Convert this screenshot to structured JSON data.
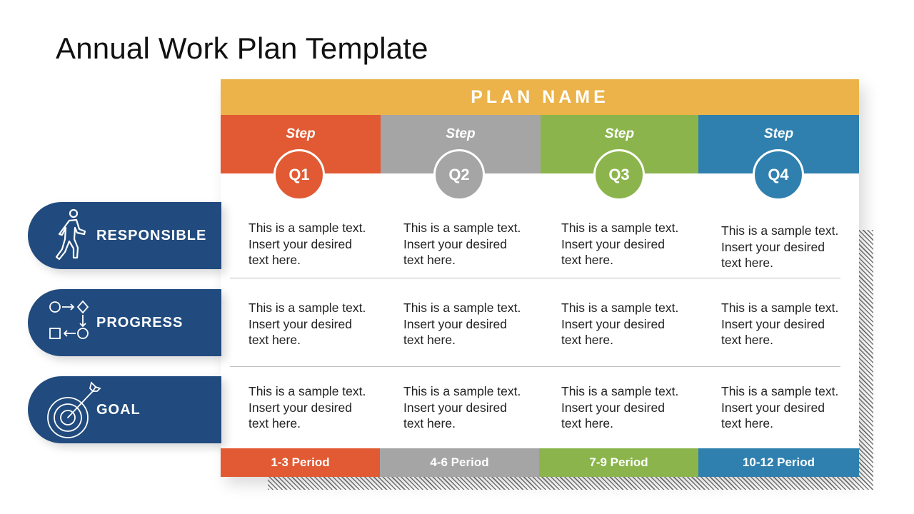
{
  "title": "Annual Work Plan Template",
  "plan_name": "PLAN NAME",
  "colors": {
    "header": "#EBB34A",
    "q1": "#E15A33",
    "q2": "#A5A5A5",
    "q3": "#8BB54C",
    "q4": "#2F80AE",
    "row_label": "#214B7E"
  },
  "columns": [
    {
      "step": "Step",
      "quarter": "Q1",
      "period": "1-3 Period"
    },
    {
      "step": "Step",
      "quarter": "Q2",
      "period": "4-6 Period"
    },
    {
      "step": "Step",
      "quarter": "Q3",
      "period": "7-9 Period"
    },
    {
      "step": "Step",
      "quarter": "Q4",
      "period": "10-12 Period"
    }
  ],
  "rows": [
    {
      "label": "RESPONSIBLE",
      "icon": "walking-person-icon",
      "cells": [
        [
          "This is a sample text.",
          "Insert your desired",
          "text here."
        ],
        [
          "This is a sample text.",
          "Insert your desired",
          "text here."
        ],
        [
          "This is a sample text.",
          "Insert your desired",
          "text here."
        ],
        [
          "This is a sample text.",
          "Insert your desired",
          "text here."
        ]
      ]
    },
    {
      "label": "PROGRESS",
      "icon": "process-flow-icon",
      "cells": [
        [
          "This is a sample text.",
          "Insert your desired",
          "text here."
        ],
        [
          "This is a sample text.",
          "Insert your desired",
          "text here."
        ],
        [
          "This is a sample text.",
          "Insert your desired",
          "text here."
        ],
        [
          "This is a sample text.",
          "Insert your desired",
          "text here."
        ]
      ]
    },
    {
      "label": "GOAL",
      "icon": "target-arrow-icon",
      "cells": [
        [
          "This is a sample text.",
          "Insert your desired",
          "text here."
        ],
        [
          "This is a sample text.",
          "Insert your desired",
          "text here."
        ],
        [
          "This is a sample text.",
          "Insert your desired",
          "text here."
        ],
        [
          "This is a sample text.",
          "Insert your desired",
          "text here."
        ]
      ]
    }
  ]
}
